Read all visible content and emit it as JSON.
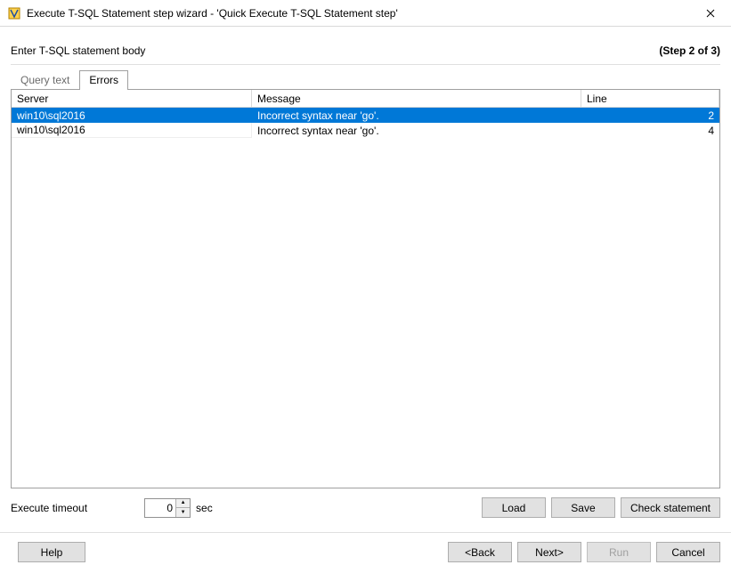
{
  "window": {
    "title": "Execute T-SQL Statement step wizard - 'Quick Execute T-SQL Statement step'"
  },
  "header": {
    "subtitle": "Enter T-SQL statement body",
    "step_count": "(Step 2 of 3)"
  },
  "tabs": {
    "query_text": "Query text",
    "errors": "Errors"
  },
  "table": {
    "headers": {
      "server": "Server",
      "message": "Message",
      "line": "Line"
    },
    "rows": [
      {
        "server": "win10\\sql2016",
        "message": "Incorrect syntax near 'go'.",
        "line": "2",
        "selected": true
      },
      {
        "server": "win10\\sql2016",
        "message": "Incorrect syntax near 'go'.",
        "line": "4",
        "selected": false
      }
    ]
  },
  "timeout": {
    "label": "Execute timeout",
    "value": "0",
    "unit": "sec"
  },
  "actions": {
    "load": "Load",
    "save": "Save",
    "check": "Check statement"
  },
  "footer": {
    "help": "Help",
    "back": "<Back",
    "next": "Next>",
    "run": "Run",
    "cancel": "Cancel"
  }
}
